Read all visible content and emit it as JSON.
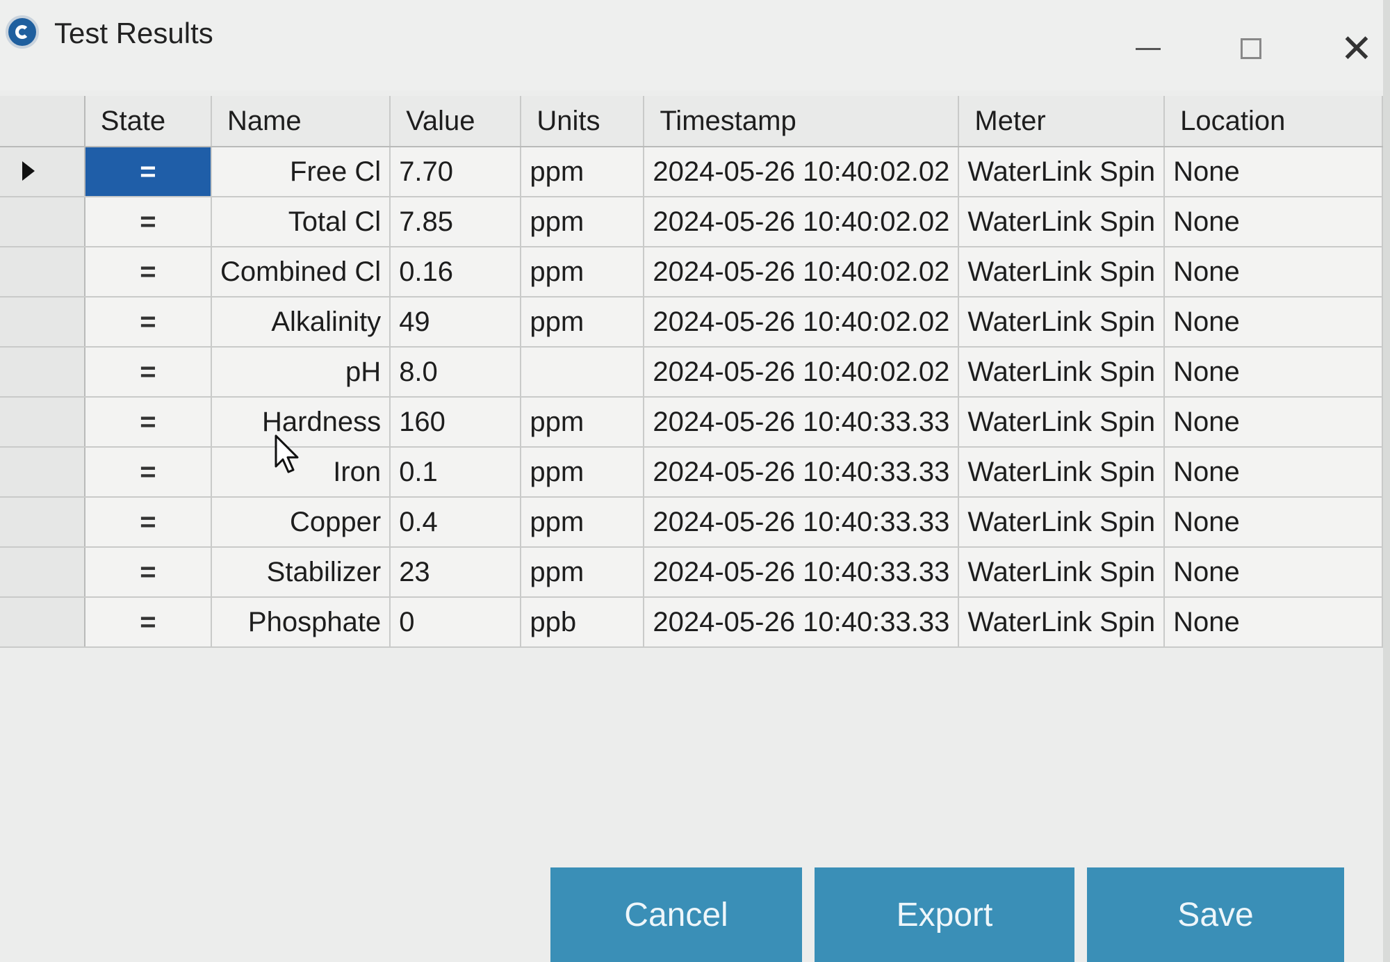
{
  "window": {
    "title": "Test Results",
    "minimize": "—",
    "close": "✕"
  },
  "grid": {
    "columns": [
      "State",
      "Name",
      "Value",
      "Units",
      "Timestamp",
      "Meter",
      "Location"
    ],
    "rows": [
      {
        "state": "=",
        "name": "Free Cl",
        "value": "7.70",
        "units": "ppm",
        "timestamp": "2024-05-26 10:40:02.02",
        "meter": "WaterLink Spin",
        "location": "None"
      },
      {
        "state": "=",
        "name": "Total Cl",
        "value": "7.85",
        "units": "ppm",
        "timestamp": "2024-05-26 10:40:02.02",
        "meter": "WaterLink Spin",
        "location": "None"
      },
      {
        "state": "=",
        "name": "Combined Cl",
        "value": "0.16",
        "units": "ppm",
        "timestamp": "2024-05-26 10:40:02.02",
        "meter": "WaterLink Spin",
        "location": "None"
      },
      {
        "state": "=",
        "name": "Alkalinity",
        "value": "49",
        "units": "ppm",
        "timestamp": "2024-05-26 10:40:02.02",
        "meter": "WaterLink Spin",
        "location": "None"
      },
      {
        "state": "=",
        "name": "pH",
        "value": "8.0",
        "units": "",
        "timestamp": "2024-05-26 10:40:02.02",
        "meter": "WaterLink Spin",
        "location": "None"
      },
      {
        "state": "=",
        "name": "Hardness",
        "value": "160",
        "units": "ppm",
        "timestamp": "2024-05-26 10:40:33.33",
        "meter": "WaterLink Spin",
        "location": "None"
      },
      {
        "state": "=",
        "name": "Iron",
        "value": "0.1",
        "units": "ppm",
        "timestamp": "2024-05-26 10:40:33.33",
        "meter": "WaterLink Spin",
        "location": "None"
      },
      {
        "state": "=",
        "name": "Copper",
        "value": "0.4",
        "units": "ppm",
        "timestamp": "2024-05-26 10:40:33.33",
        "meter": "WaterLink Spin",
        "location": "None"
      },
      {
        "state": "=",
        "name": "Stabilizer",
        "value": "23",
        "units": "ppm",
        "timestamp": "2024-05-26 10:40:33.33",
        "meter": "WaterLink Spin",
        "location": "None"
      },
      {
        "state": "=",
        "name": "Phosphate",
        "value": "0",
        "units": "ppb",
        "timestamp": "2024-05-26 10:40:33.33",
        "meter": "WaterLink Spin",
        "location": "None"
      }
    ],
    "selected_row": 0
  },
  "buttons": {
    "cancel": "Cancel",
    "export": "Export",
    "save": "Save"
  },
  "colors": {
    "selection": "#1f5ea8",
    "button": "#3a8fb7"
  }
}
